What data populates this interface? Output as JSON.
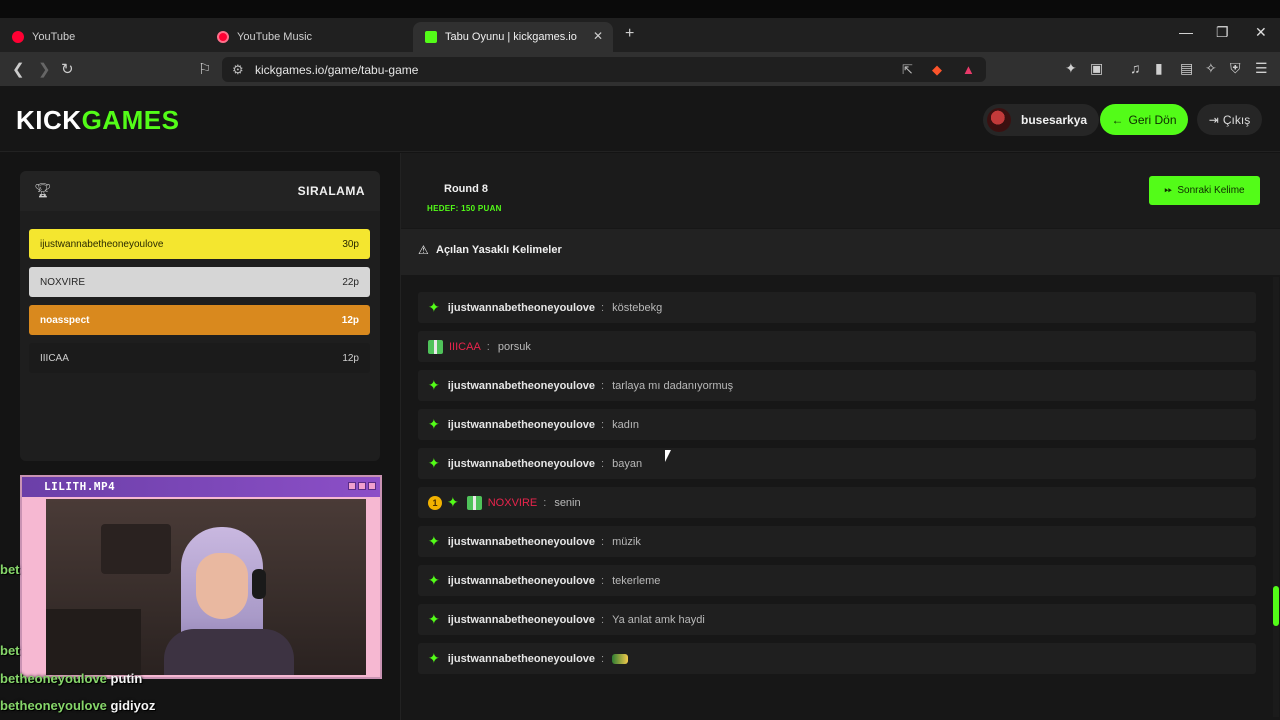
{
  "browser": {
    "tabs": [
      {
        "label": "YouTube",
        "icon": "youtube-icon",
        "color": "#ff0033"
      },
      {
        "label": "YouTube Music",
        "icon": "youtube-music-icon",
        "color": "#ff0033"
      },
      {
        "label": "Tabu Oyunu | kickgames.io",
        "icon": "kickgames-icon",
        "color": "#53fc18",
        "active": true
      }
    ],
    "url": "kickgames.io/game/tabu-game"
  },
  "header": {
    "logo_left": "KICK",
    "logo_right": "GAMES",
    "username": "busesarkya",
    "back_label": "Geri Dön",
    "exit_label": "Çıkış",
    "accent": "#53fc18"
  },
  "ranking": {
    "title": "SIRALAMA",
    "rows": [
      {
        "name": "ijustwannabetheoneyoulove",
        "score": "30p",
        "bg": "#f4e62f",
        "fg": "#2a2a00"
      },
      {
        "name": "NOXVIRE",
        "score": "22p",
        "bg": "#d6d6d6",
        "fg": "#262626"
      },
      {
        "name": "noasspect",
        "score": "12p",
        "bg": "#d9891e",
        "fg": "#ffffff"
      },
      {
        "name": "IIICAA",
        "score": "12p",
        "bg": "#1e1e1e",
        "fg": "#cfcfcf"
      }
    ]
  },
  "webcam": {
    "title": "LILITH.MP4"
  },
  "overlay_chat": [
    {
      "user": "bet",
      "text": ""
    },
    {
      "user": "bet",
      "text": ""
    },
    {
      "user": "betheoneyoulove",
      "text": "putin"
    },
    {
      "user": "betheoneyoulove",
      "text": "gidiyoz"
    }
  ],
  "game": {
    "round": "Round 8",
    "target": "HEDEF: 150 PUAN",
    "next_label": "Sonraki Kelime",
    "banned_title": "Açılan Yasaklı Kelimeler"
  },
  "chat": [
    {
      "user": "ijustwannabetheoneyoulove",
      "text": "köstebekg",
      "style": "normal"
    },
    {
      "user": "IIICAA",
      "text": "porsuk",
      "style": "gift"
    },
    {
      "user": "ijustwannabetheoneyoulove",
      "text": "tarlaya mı dadanıyormuş",
      "style": "normal"
    },
    {
      "user": "ijustwannabetheoneyoulove",
      "text": "kadın",
      "style": "normal"
    },
    {
      "user": "ijustwannabetheoneyoulove",
      "text": "bayan",
      "style": "normal"
    },
    {
      "user": "NOXVIRE",
      "text": "senin",
      "style": "badge"
    },
    {
      "user": "ijustwannabetheoneyoulove",
      "text": "müzik",
      "style": "normal"
    },
    {
      "user": "ijustwannabetheoneyoulove",
      "text": "tekerleme",
      "style": "normal"
    },
    {
      "user": "ijustwannabetheoneyoulove",
      "text": "Ya anlat amk haydi",
      "style": "normal"
    },
    {
      "user": "ijustwannabetheoneyoulove",
      "text": "",
      "style": "emote"
    }
  ]
}
